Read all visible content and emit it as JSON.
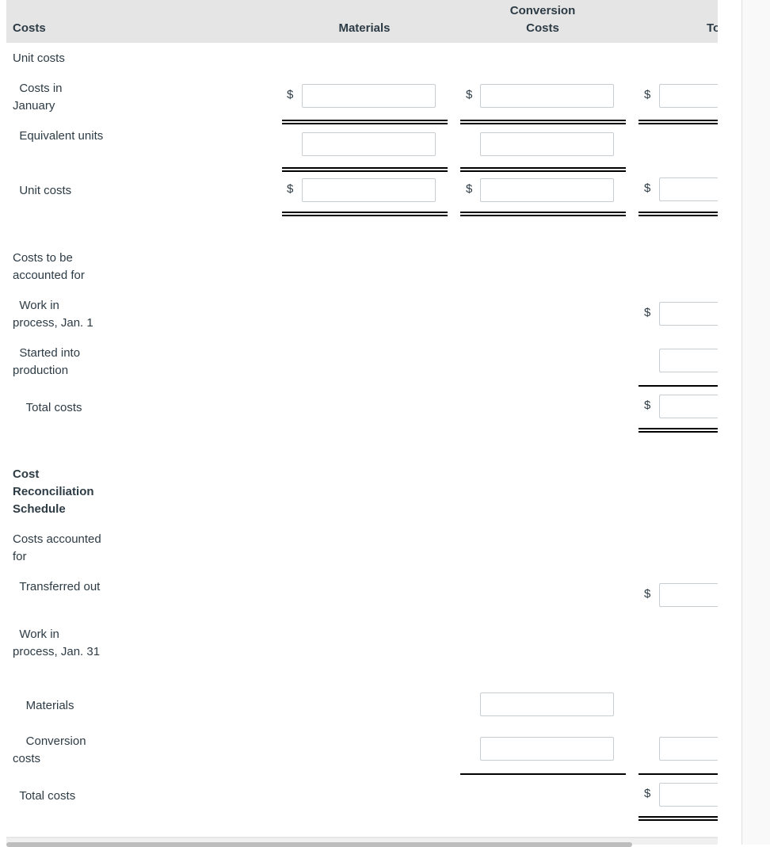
{
  "header": {
    "costs": "Costs",
    "materials": "Materials",
    "conversion_line1": "Conversion",
    "conversion_line2": "Costs",
    "total": "Total"
  },
  "currency_symbol": "$",
  "rows": {
    "unit_costs": "Unit costs",
    "costs_in_january": "  Costs in January",
    "equivalent_units": "  Equivalent units",
    "unit_costs_sub": "  Unit costs",
    "costs_to_be_accounted": "Costs to be accounted for",
    "wip_jan1": "  Work in process, Jan. 1",
    "started": "  Started into production",
    "total_costs_1": "    Total costs",
    "reconciliation": "Cost Reconciliation Schedule",
    "costs_accounted": "Costs accounted for",
    "transferred_out": "  Transferred out",
    "wip_jan31": "  Work in process, Jan. 31",
    "materials": "    Materials",
    "conversion_costs": "    Conversion costs",
    "total_costs_2": "  Total costs"
  },
  "inputs": {
    "costs_jan_materials": "",
    "costs_jan_conversion": "",
    "costs_jan_total": "",
    "eq_units_materials": "",
    "eq_units_conversion": "",
    "unit_costs_materials": "",
    "unit_costs_conversion": "",
    "unit_costs_total": "",
    "wip_jan1_total": "",
    "started_total": "",
    "total_costs_1_total": "",
    "transferred_out_total": "",
    "wip_materials_conversion_col": "",
    "wip_conversion_conversion_col": "",
    "wip_conversion_total": "",
    "total_costs_2_total": ""
  }
}
